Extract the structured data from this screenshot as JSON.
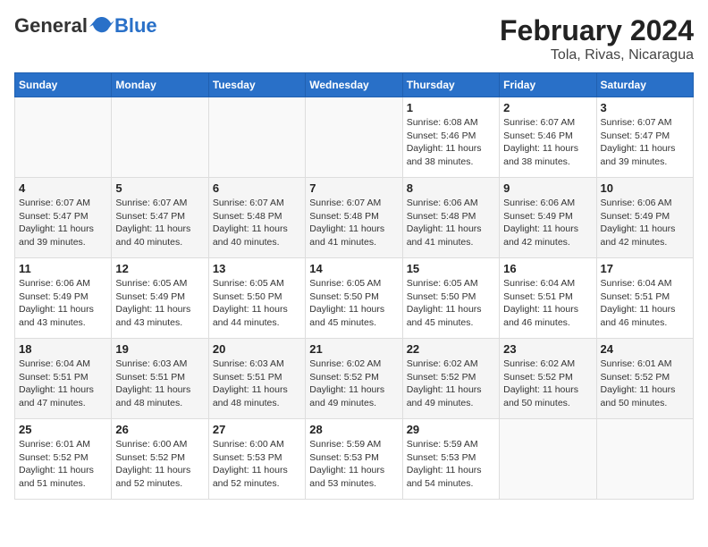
{
  "header": {
    "logo_general": "General",
    "logo_blue": "Blue",
    "title": "February 2024",
    "subtitle": "Tola, Rivas, Nicaragua"
  },
  "days_of_week": [
    "Sunday",
    "Monday",
    "Tuesday",
    "Wednesday",
    "Thursday",
    "Friday",
    "Saturday"
  ],
  "weeks": [
    [
      {
        "day": "",
        "info": ""
      },
      {
        "day": "",
        "info": ""
      },
      {
        "day": "",
        "info": ""
      },
      {
        "day": "",
        "info": ""
      },
      {
        "day": "1",
        "info": "Sunrise: 6:08 AM\nSunset: 5:46 PM\nDaylight: 11 hours\nand 38 minutes."
      },
      {
        "day": "2",
        "info": "Sunrise: 6:07 AM\nSunset: 5:46 PM\nDaylight: 11 hours\nand 38 minutes."
      },
      {
        "day": "3",
        "info": "Sunrise: 6:07 AM\nSunset: 5:47 PM\nDaylight: 11 hours\nand 39 minutes."
      }
    ],
    [
      {
        "day": "4",
        "info": "Sunrise: 6:07 AM\nSunset: 5:47 PM\nDaylight: 11 hours\nand 39 minutes."
      },
      {
        "day": "5",
        "info": "Sunrise: 6:07 AM\nSunset: 5:47 PM\nDaylight: 11 hours\nand 40 minutes."
      },
      {
        "day": "6",
        "info": "Sunrise: 6:07 AM\nSunset: 5:48 PM\nDaylight: 11 hours\nand 40 minutes."
      },
      {
        "day": "7",
        "info": "Sunrise: 6:07 AM\nSunset: 5:48 PM\nDaylight: 11 hours\nand 41 minutes."
      },
      {
        "day": "8",
        "info": "Sunrise: 6:06 AM\nSunset: 5:48 PM\nDaylight: 11 hours\nand 41 minutes."
      },
      {
        "day": "9",
        "info": "Sunrise: 6:06 AM\nSunset: 5:49 PM\nDaylight: 11 hours\nand 42 minutes."
      },
      {
        "day": "10",
        "info": "Sunrise: 6:06 AM\nSunset: 5:49 PM\nDaylight: 11 hours\nand 42 minutes."
      }
    ],
    [
      {
        "day": "11",
        "info": "Sunrise: 6:06 AM\nSunset: 5:49 PM\nDaylight: 11 hours\nand 43 minutes."
      },
      {
        "day": "12",
        "info": "Sunrise: 6:05 AM\nSunset: 5:49 PM\nDaylight: 11 hours\nand 43 minutes."
      },
      {
        "day": "13",
        "info": "Sunrise: 6:05 AM\nSunset: 5:50 PM\nDaylight: 11 hours\nand 44 minutes."
      },
      {
        "day": "14",
        "info": "Sunrise: 6:05 AM\nSunset: 5:50 PM\nDaylight: 11 hours\nand 45 minutes."
      },
      {
        "day": "15",
        "info": "Sunrise: 6:05 AM\nSunset: 5:50 PM\nDaylight: 11 hours\nand 45 minutes."
      },
      {
        "day": "16",
        "info": "Sunrise: 6:04 AM\nSunset: 5:51 PM\nDaylight: 11 hours\nand 46 minutes."
      },
      {
        "day": "17",
        "info": "Sunrise: 6:04 AM\nSunset: 5:51 PM\nDaylight: 11 hours\nand 46 minutes."
      }
    ],
    [
      {
        "day": "18",
        "info": "Sunrise: 6:04 AM\nSunset: 5:51 PM\nDaylight: 11 hours\nand 47 minutes."
      },
      {
        "day": "19",
        "info": "Sunrise: 6:03 AM\nSunset: 5:51 PM\nDaylight: 11 hours\nand 48 minutes."
      },
      {
        "day": "20",
        "info": "Sunrise: 6:03 AM\nSunset: 5:51 PM\nDaylight: 11 hours\nand 48 minutes."
      },
      {
        "day": "21",
        "info": "Sunrise: 6:02 AM\nSunset: 5:52 PM\nDaylight: 11 hours\nand 49 minutes."
      },
      {
        "day": "22",
        "info": "Sunrise: 6:02 AM\nSunset: 5:52 PM\nDaylight: 11 hours\nand 49 minutes."
      },
      {
        "day": "23",
        "info": "Sunrise: 6:02 AM\nSunset: 5:52 PM\nDaylight: 11 hours\nand 50 minutes."
      },
      {
        "day": "24",
        "info": "Sunrise: 6:01 AM\nSunset: 5:52 PM\nDaylight: 11 hours\nand 50 minutes."
      }
    ],
    [
      {
        "day": "25",
        "info": "Sunrise: 6:01 AM\nSunset: 5:52 PM\nDaylight: 11 hours\nand 51 minutes."
      },
      {
        "day": "26",
        "info": "Sunrise: 6:00 AM\nSunset: 5:52 PM\nDaylight: 11 hours\nand 52 minutes."
      },
      {
        "day": "27",
        "info": "Sunrise: 6:00 AM\nSunset: 5:53 PM\nDaylight: 11 hours\nand 52 minutes."
      },
      {
        "day": "28",
        "info": "Sunrise: 5:59 AM\nSunset: 5:53 PM\nDaylight: 11 hours\nand 53 minutes."
      },
      {
        "day": "29",
        "info": "Sunrise: 5:59 AM\nSunset: 5:53 PM\nDaylight: 11 hours\nand 54 minutes."
      },
      {
        "day": "",
        "info": ""
      },
      {
        "day": "",
        "info": ""
      }
    ]
  ]
}
